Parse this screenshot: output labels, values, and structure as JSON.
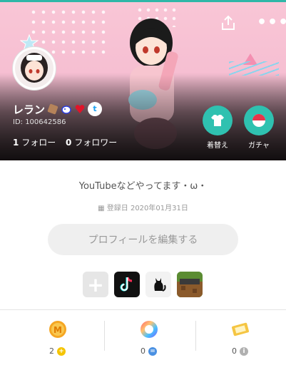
{
  "profile": {
    "name": "レラン",
    "user_id": "ID: 100642586",
    "follow_count": "1",
    "follow_label": "フォロー",
    "follower_count": "0",
    "follower_label": "フォロワー",
    "twitter_glyph": "t",
    "badges": [
      "chocolate-badge",
      "dog-badge",
      "heart-badge"
    ]
  },
  "actions": {
    "outfit_label": "着替え",
    "gacha_label": "ガチャ",
    "more_glyph": "•••"
  },
  "bio": "YouTubeなどやってます・ω・",
  "joined": "登録日 2020年01月31日",
  "edit_profile_label": "プロフィールを編集する",
  "links": {
    "add_glyph": "+",
    "items": [
      "tiktok-icon",
      "cat-icon",
      "minecraft-icon"
    ]
  },
  "stats": [
    {
      "value": "2",
      "icon": "coin-icon",
      "mini_glyph": "+"
    },
    {
      "value": "0",
      "icon": "color-orb-icon",
      "mini_glyph": "="
    },
    {
      "value": "0",
      "icon": "ticket-icon",
      "mini_glyph": "i"
    }
  ],
  "colors": {
    "accent": "#2fc1b0",
    "banner_pink": "#f9c6d6",
    "text_dark": "#555555"
  }
}
